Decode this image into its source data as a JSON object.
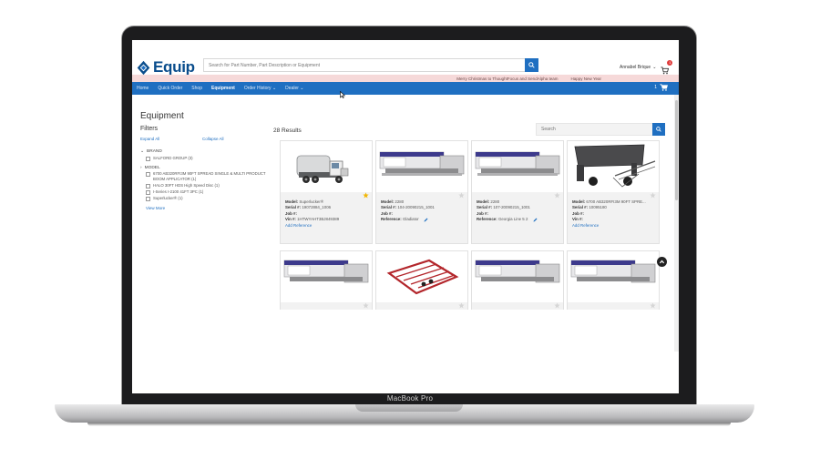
{
  "device": {
    "label": "MacBook Pro"
  },
  "app": {
    "logo_text": "Equip",
    "search": {
      "placeholder": "Search for Part Number, Part Description or Equipment",
      "value": ""
    },
    "user_name": "Annabel Brique",
    "cart_badge": "1"
  },
  "announcement": {
    "messages": [
      "Merry Christmas to ThoughtFocus and SendAlpha team",
      "Happy New Year"
    ]
  },
  "nav": {
    "items": [
      "Home",
      "Quick Order",
      "Shop",
      "Equipment",
      "Order History",
      "Dealer"
    ],
    "active": "Equipment",
    "cart_count": "1"
  },
  "page": {
    "title": "Equipment"
  },
  "filters": {
    "title": "Filters",
    "expand_all": "Expand All",
    "collapse_all": "Collapse All",
    "brand_label": "BRAND",
    "brand_options": [
      "SALFORD GROUP (3)"
    ],
    "model_label": "MODEL",
    "model_options": [
      "6700 AB320RFI3M 90FT SPREAD SINGLE & MULTI PRODUCT BOOM APPLICATOR (1)",
      "HALO 30FT HDS High Speed Disc (1)",
      "I-Series I-2100 41FT 3PC (1)",
      "Superlucker® (1)"
    ],
    "view_more": "View More"
  },
  "results": {
    "count_label": "28 Results",
    "search_placeholder": "Search",
    "labels": {
      "model": "Model:",
      "serial": "Serial #:",
      "job": "Job #:",
      "vin": "Vin #:",
      "reference": "Reference:",
      "add_reference": "Add Reference"
    },
    "cards": [
      {
        "model": "Superlucker®",
        "serial": "19072884_1006",
        "job": "",
        "vin": "1HTWYAHT3BJ849389",
        "reference": "",
        "favorite": true,
        "image": "truck-image"
      },
      {
        "model": "2280",
        "serial": "104-20090215_1001",
        "job": "",
        "vin": "",
        "reference": "Gladiator",
        "favorite": false,
        "image": "machine-image"
      },
      {
        "model": "2280",
        "serial": "107-20090215_1001",
        "job": "",
        "vin": "",
        "reference": "Georgia Line 5 2",
        "favorite": false,
        "image": "machine-image"
      },
      {
        "model": "6700 AB320RFI3M 90FT SPRE...",
        "serial": "10095180",
        "job": "",
        "vin": "",
        "reference": "",
        "favorite": false,
        "image": "applicator-image"
      },
      {
        "favorite": false,
        "image": "machine-image"
      },
      {
        "favorite": false,
        "image": "implement-image"
      },
      {
        "favorite": false,
        "image": "machine-image"
      },
      {
        "favorite": false,
        "image": "machine-image"
      }
    ]
  },
  "colors": {
    "primary": "#1f6fc1",
    "logo": "#0a4d8c",
    "announcement_bg": "#f6d9d9",
    "star_active": "#f2b705",
    "badge": "#e03a3a"
  }
}
